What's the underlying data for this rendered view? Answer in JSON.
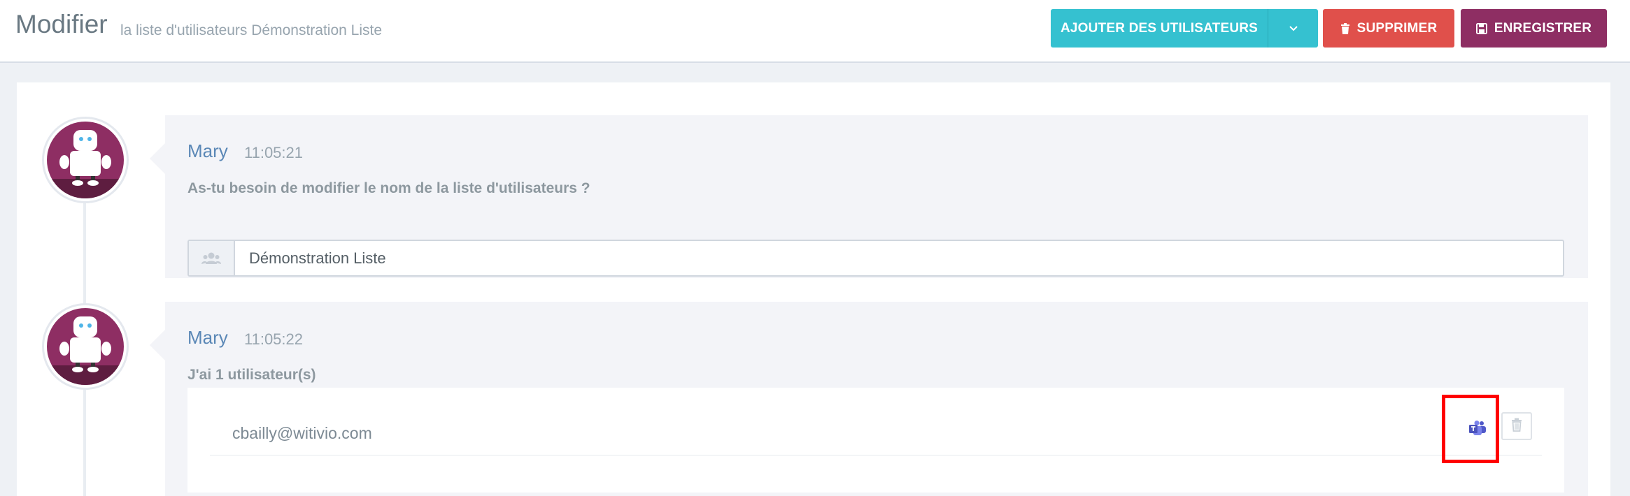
{
  "header": {
    "title": "Modifier",
    "subtitle": "la liste d'utilisateurs Démonstration Liste",
    "buttons": {
      "add_users": "AJOUTER DES UTILISATEURS",
      "delete": "SUPPRIMER",
      "save": "ENREGISTRER"
    }
  },
  "messages": [
    {
      "author": "Mary",
      "time": "11:05:21",
      "question": "As-tu besoin de modifier le nom de la liste d'utilisateurs ?",
      "input_value": "Démonstration Liste"
    },
    {
      "author": "Mary",
      "time": "11:05:22",
      "question": "J'ai 1 utilisateur(s)",
      "users": [
        {
          "email": "cbailly@witivio.com"
        }
      ]
    }
  ],
  "icons": {
    "add_caret": "chevron-down-icon",
    "delete": "trash-icon",
    "save": "floppy-icon",
    "input_addon": "users-icon",
    "teams": "teams-icon",
    "remove_user": "trash-icon"
  },
  "colors": {
    "add_button": "#35c1d0",
    "delete_button": "#e0504b",
    "save_button": "#8e2e63",
    "avatar_bg": "#8e2e63",
    "author": "#5a87b6",
    "highlight": "#ff0000"
  }
}
